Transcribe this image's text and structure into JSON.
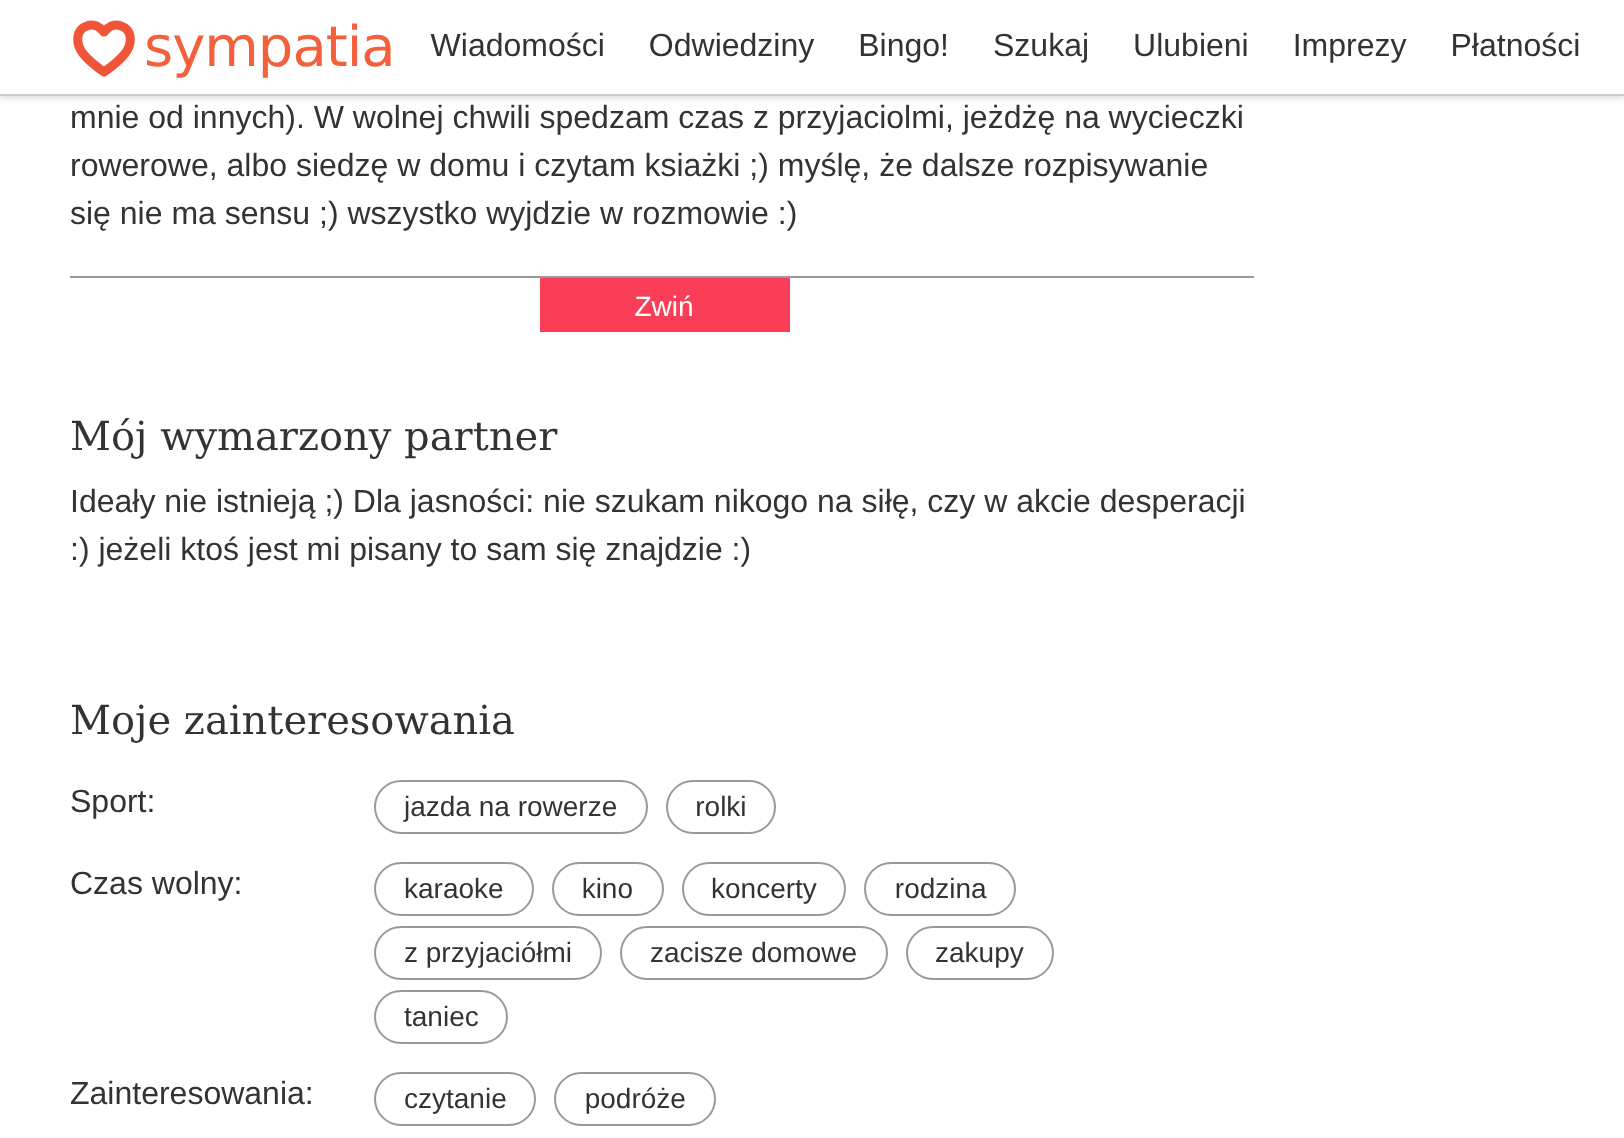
{
  "header": {
    "logo": "sympatia",
    "nav": [
      "Wiadomości",
      "Odwiedziny",
      "Bingo!",
      "Szukaj",
      "Ulubieni",
      "Imprezy",
      "Płatności"
    ]
  },
  "about": {
    "text": "mnie od innych). W wolnej chwili spedzam czas z przyjaciolmi, jeżdżę na wycieczki rowerowe, albo siedzę w domu i czytam ksiażki ;) myślę, że dalsze rozpisywanie się nie ma sensu ;) wszystko wyjdzie w rozmowie :)",
    "collapse_button": "Zwiń"
  },
  "partner": {
    "title": "Mój wymarzony partner",
    "text": "Ideały nie istnieją ;) Dla jasności: nie szukam nikogo na siłę, czy w akcie desperacji :) jeżeli ktoś jest mi pisany to sam się znajdzie :)"
  },
  "interests": {
    "title": "Moje zainteresowania",
    "groups": [
      {
        "label": "Sport:",
        "tags": [
          "jazda na rowerze",
          "rolki"
        ]
      },
      {
        "label": "Czas wolny:",
        "tags": [
          "karaoke",
          "kino",
          "koncerty",
          "rodzina",
          "z przyjaciółmi",
          "zacisze domowe",
          "zakupy",
          "taniec"
        ]
      },
      {
        "label": "Zainteresowania:",
        "tags": [
          "czytanie",
          "podróże"
        ]
      }
    ]
  }
}
